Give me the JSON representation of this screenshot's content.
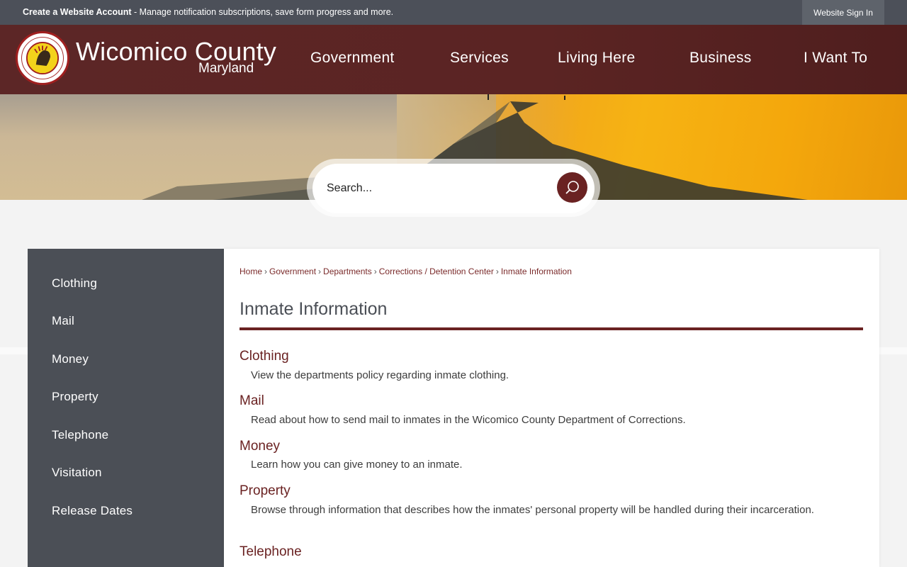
{
  "topbar": {
    "create_account": "Create a Website Account",
    "message": " - Manage notification subscriptions, save form progress and more.",
    "sign_in": "Website Sign In"
  },
  "header": {
    "title": "Wicomico County",
    "subtitle": "Maryland",
    "seal_icon": "county-seal-icon",
    "nav": [
      "Government",
      "Services",
      "Living Here",
      "Business",
      "I Want To"
    ]
  },
  "search": {
    "placeholder": "Search...",
    "icon": "search-icon"
  },
  "sidebar": {
    "items": [
      "Clothing",
      "Mail",
      "Money",
      "Property",
      "Telephone",
      "Visitation",
      "Release Dates"
    ]
  },
  "breadcrumb": [
    "Home",
    "Government",
    "Departments",
    "Corrections / Detention Center",
    "Inmate Information"
  ],
  "page_title": "Inmate Information",
  "items": [
    {
      "title": "Clothing",
      "desc": "View the departments policy regarding inmate clothing."
    },
    {
      "title": "Mail",
      "desc": "Read about how to send mail to inmates in the Wicomico County Department of Corrections."
    },
    {
      "title": "Money",
      "desc": "Learn how you can give money to an inmate."
    },
    {
      "title": "Property",
      "desc": "Browse through information that describes how the inmates' personal property will be handled during their incarceration."
    },
    {
      "title": "Telephone",
      "desc": ""
    }
  ],
  "colors": {
    "brand": "#5c2626",
    "accent": "#6a2222",
    "sidebar": "#4b4f56"
  }
}
